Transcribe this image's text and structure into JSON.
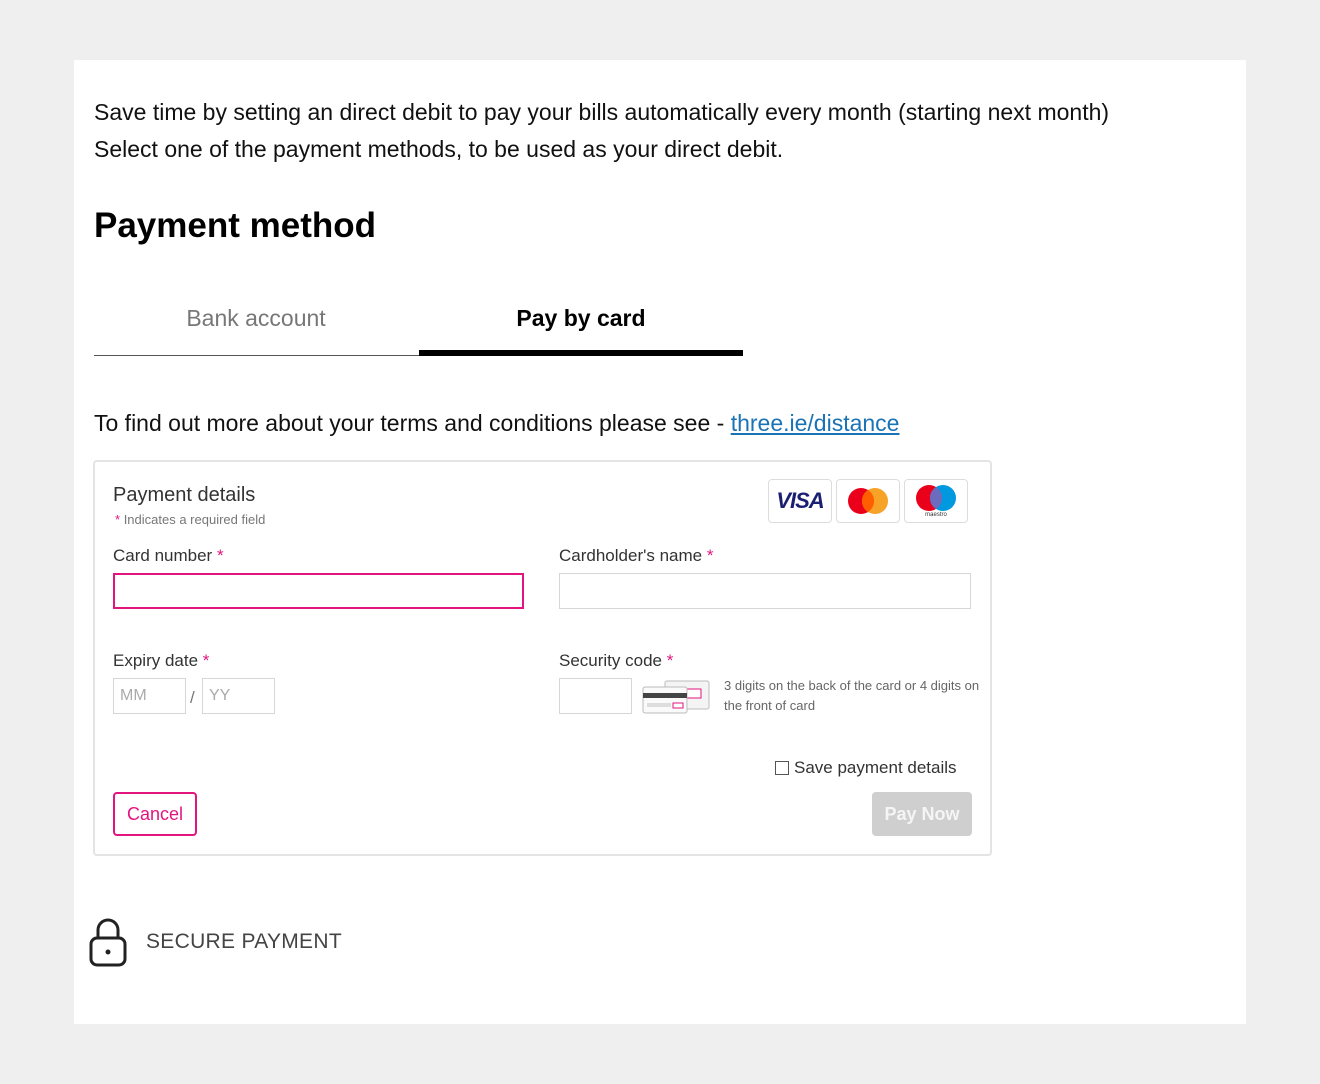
{
  "intro": {
    "line1": "Save time by setting an direct debit to pay your bills automatically every month (starting next month)",
    "line2": "Select one of the payment methods, to be used as your direct debit."
  },
  "heading": "Payment method",
  "tabs": [
    {
      "label": "Bank account",
      "active": false
    },
    {
      "label": "Pay by card",
      "active": true
    }
  ],
  "terms": {
    "text": "To find out more about your terms and conditions please see - ",
    "link_text": "three.ie/distance"
  },
  "payment_details": {
    "title": "Payment details",
    "required_note": "Indicates a required field",
    "required_marker": "*",
    "card_logos": [
      "visa-logo",
      "mastercard-logo",
      "maestro-logo"
    ],
    "visa_text": "VISA",
    "maestro_text": "maestro",
    "card_number": {
      "label": "Card number",
      "value": ""
    },
    "cardholder_name": {
      "label": "Cardholder's name",
      "value": ""
    },
    "expiry": {
      "label": "Expiry date",
      "month_placeholder": "MM",
      "year_placeholder": "YY",
      "separator": "/"
    },
    "security_code": {
      "label": "Security code",
      "value": "",
      "hint": "3 digits on the back of the card or 4 digits on the front of card"
    },
    "save_details_label": "Save payment details",
    "save_details_checked": false,
    "cancel_label": "Cancel",
    "pay_label": "Pay Now"
  },
  "secure": {
    "label": "SECURE PAYMENT",
    "icon": "lock-icon"
  },
  "colors": {
    "accent": "#e2157e",
    "link": "#1a73b5",
    "disabled_button": "#cfcfcf",
    "background": "#efeff0"
  }
}
